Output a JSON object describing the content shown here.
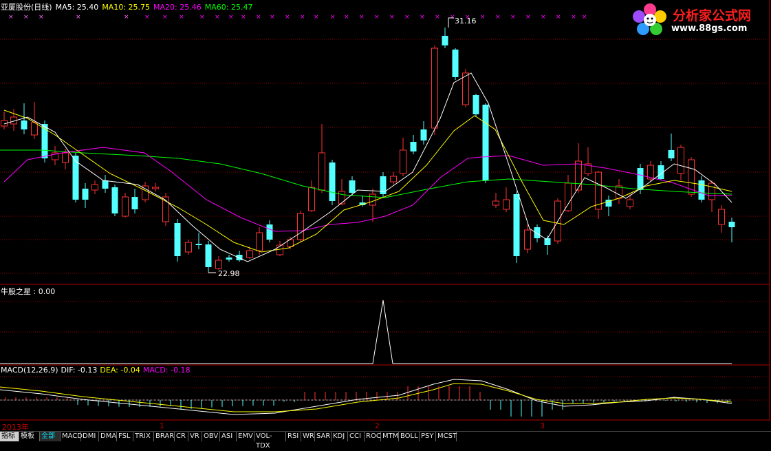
{
  "header": {
    "stock_name": "亚厦股份(日线)",
    "ma5": "MA5: 25.40",
    "ma10": "MA10: 25.75",
    "ma20": "MA20: 25.46",
    "ma60": "MA60: 25.47"
  },
  "indicator_panel": {
    "title": "牛股之星 : 0.00"
  },
  "macd_panel": {
    "name": "MACD(12,26,9)",
    "dif": "DIF: -0.13",
    "dea": "DEA: -0.04",
    "macd": "MACD: -0.18"
  },
  "annotations": {
    "high": "31.16",
    "low": "22.98"
  },
  "logo": {
    "brand": "分析家公式网",
    "url": "www.88gs.com"
  },
  "time_axis": {
    "labels": [
      "2013年",
      "1",
      "2",
      "3"
    ]
  },
  "tabs": [
    "指标",
    "模板",
    "全部",
    "MACD",
    "DMI",
    "DMA",
    "FSL",
    "TRIX",
    "BRAR",
    "CR",
    "VR",
    "OBV",
    "ASI",
    "EMV",
    "VOL-TDX",
    "RSI",
    "WR",
    "SAR",
    "KDJ",
    "CCI",
    "ROC",
    "MTM",
    "BOLL",
    "PSY",
    "MCST"
  ],
  "colors": {
    "up": "#ff3232",
    "down": "#54ffff",
    "ma5": "#ffffff",
    "ma10": "#ffff00",
    "ma20": "#ff00ff",
    "ma60": "#00ff00",
    "grid": "#8b0000",
    "border": "#b00000"
  },
  "chart_data": [
    {
      "type": "candlestick",
      "title": "亚厦股份(日线)",
      "y_range": [
        22.98,
        31.16
      ],
      "series": [
        {
          "name": "MA5",
          "last": 25.4
        },
        {
          "name": "MA10",
          "last": 25.75
        },
        {
          "name": "MA20",
          "last": 25.46
        },
        {
          "name": "MA60",
          "last": 25.47
        }
      ],
      "annotations": [
        {
          "label": "31.16",
          "kind": "high"
        },
        {
          "label": "22.98",
          "kind": "low"
        }
      ]
    },
    {
      "type": "line",
      "title": "牛股之星",
      "last": 0.0
    },
    {
      "type": "bar",
      "title": "MACD(12,26,9)",
      "series": [
        {
          "name": "DIF",
          "last": -0.13
        },
        {
          "name": "DEA",
          "last": -0.04
        },
        {
          "name": "MACD",
          "last": -0.18
        }
      ]
    }
  ]
}
